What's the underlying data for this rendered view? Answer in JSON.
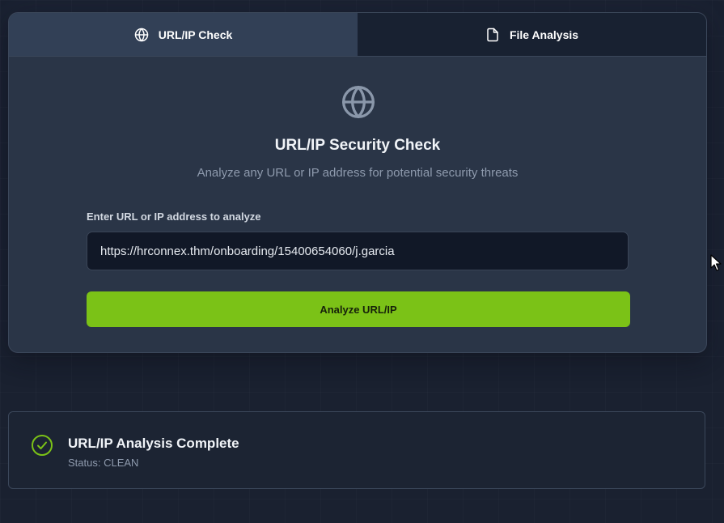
{
  "tabs": [
    {
      "label": "URL/IP Check",
      "icon": "globe-icon",
      "active": true
    },
    {
      "label": "File Analysis",
      "icon": "file-icon",
      "active": false
    }
  ],
  "hero": {
    "icon": "globe-icon",
    "title": "URL/IP Security Check",
    "subtitle": "Analyze any URL or IP address for potential security threats"
  },
  "form": {
    "label": "Enter URL or IP address to analyze",
    "value": "https://hrconnex.thm/onboarding/15400654060/j.garcia",
    "button_label": "Analyze URL/IP"
  },
  "result": {
    "icon": "check-circle-icon",
    "title": "URL/IP Analysis Complete",
    "status": "Status: CLEAN"
  },
  "colors": {
    "background": "#1a2130",
    "card": "#2a3547",
    "accent_green": "#7bc217",
    "muted_text": "#8e9aad"
  }
}
